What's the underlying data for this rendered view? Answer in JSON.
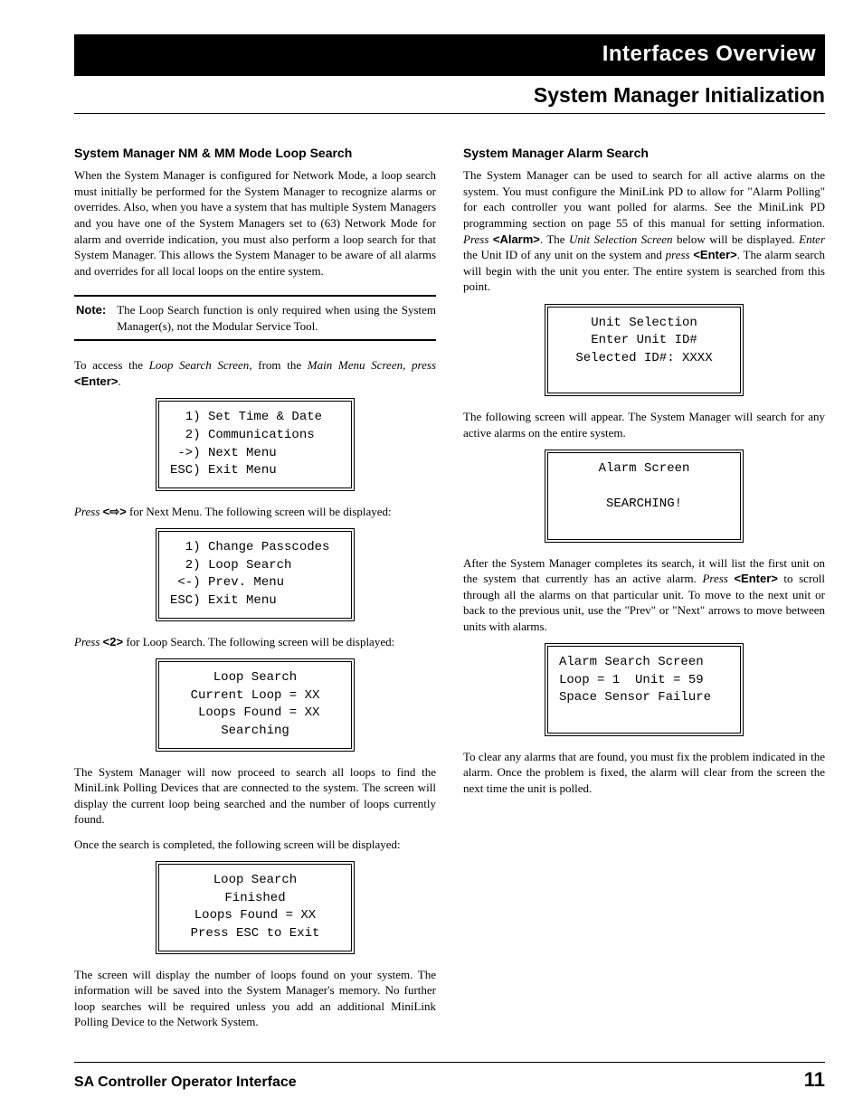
{
  "header": {
    "banner": "Interfaces Overview",
    "title": "System Manager Initialization"
  },
  "left": {
    "h1": "System Manager NM & MM Mode Loop Search",
    "p1": "When the System Manager is configured for Network Mode, a loop search must initially be performed for the System Manager to recognize alarms or overrides. Also, when you have a system that has multiple System Managers and you have one of the System Managers set to (63) Network Mode for alarm and override indication, you must also perform a loop search for that System Manager. This allows the System Manager to be aware of all alarms and overrides for all local loops on the entire system.",
    "note_label": "Note:",
    "note_text": "The Loop Search function is only required when using the System Manager(s), not the Modular Service Tool.",
    "p2_a": "To access the ",
    "p2_b": "Loop Search Screen",
    "p2_c": ", from the ",
    "p2_d": "Main Menu Screen",
    "p2_e": ", ",
    "p2_f": "press",
    "p2_g": " ",
    "p2_enter": "<Enter>",
    "p2_h": ".",
    "screen1": "  1) Set Time & Date\n  2) Communications\n ->) Next Menu\nESC) Exit Menu",
    "p3_a": "Press",
    "p3_b": " ",
    "p3_key_open": "<",
    "p3_key_close": ">",
    "p3_c": " for Next Menu. The following screen will be displayed:",
    "screen2": "  1) Change Passcodes\n  2) Loop Search\n <-) Prev. Menu\nESC) Exit Menu",
    "p4_a": "Press",
    "p4_key": "<2>",
    "p4_b": " for Loop Search. The following screen will be displayed:",
    "screen3_l1": "Loop Search",
    "screen3_l2": "Current Loop = XX",
    "screen3_l3": " Loops Found = XX",
    "screen3_l4": "Searching",
    "p5": "The System Manager will now proceed to search all loops to find the MiniLink Polling Devices that are connected to the system. The screen will display the current loop being searched and the number of loops currently found.",
    "p6": "Once the search is completed, the following screen will be displayed:",
    "screen4_l1": "Loop Search",
    "screen4_l2": "Finished",
    "screen4_l3": "Loops Found = XX",
    "screen4_l4": "Press ESC to Exit",
    "p7": "The screen will display the number of loops found on your system. The information will be saved into the System Manager's memory. No further loop searches will be required unless you add an additional MiniLink Polling Device to the Network System."
  },
  "right": {
    "h1": "System Manager Alarm Search",
    "p1_a": "The System Manager can be used to search for all active alarms on the system. You must configure the MiniLink PD to allow for \"Alarm Polling\" for each controller you want polled for alarms. See the MiniLink PD programming section on page 55 of this manual for setting information. ",
    "p1_press": "Press",
    "p1_alarm": "<Alarm>",
    "p1_b": ". The ",
    "p1_uss": "Unit Selection Screen",
    "p1_c": " below will be displayed. ",
    "p1_enter_word": "Enter",
    "p1_d": " the Unit ID of any unit on the system and ",
    "p1_press2": "press",
    "p1_enter_key": "<Enter>",
    "p1_e": ". The alarm search will begin with the unit you enter. The entire system is searched from this point.",
    "screen1_l1": "Unit Selection",
    "screen1_l2": "Enter Unit ID#",
    "screen1_l3": "Selected ID#: XXXX",
    "p2": "The following screen will appear. The System Manager will search for any active alarms on the entire system.",
    "screen2_l1": "Alarm Screen",
    "screen2_l2": "SEARCHING!",
    "p3_a": "After the System Manager completes its search, it will list the first unit on the system that currently has an active alarm. ",
    "p3_press": "Press",
    "p3_enter": "<Enter>",
    "p3_b": " to scroll through all the alarms on that particular unit. To move to the next unit or back to the previous unit, use the \"Prev\" or \"Next\" arrows to move between units with alarms.",
    "screen3_l1": "Alarm Search Screen",
    "screen3_l2": "Loop = 1  Unit = 59",
    "screen3_l3": "Space Sensor Failure",
    "p4": "To clear any alarms that are found, you must fix the problem indicated in the alarm. Once the problem is fixed, the alarm will clear from the screen the next time the unit is polled."
  },
  "footer": {
    "left": "SA Controller Operator Interface",
    "right": "11"
  }
}
